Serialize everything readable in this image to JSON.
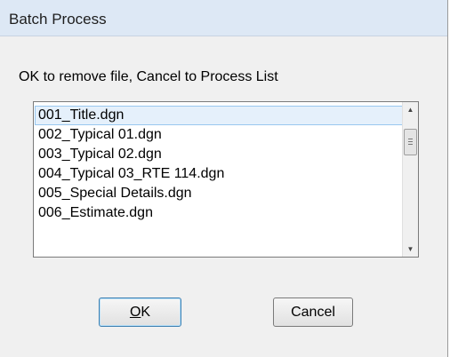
{
  "window": {
    "title": "Batch Process"
  },
  "prompt": "OK to remove file, Cancel to Process List",
  "file_list": {
    "selected_index": 0,
    "items": [
      "001_Title.dgn",
      "002_Typical 01.dgn",
      "003_Typical 02.dgn",
      "004_Typical 03_RTE 114.dgn",
      "005_Special Details.dgn",
      "006_Estimate.dgn"
    ]
  },
  "icons": {
    "scroll_up": "chevron-up-icon",
    "scroll_down": "chevron-down-icon"
  },
  "buttons": {
    "ok_mnemonic": "O",
    "ok_rest": "K",
    "cancel": "Cancel"
  }
}
